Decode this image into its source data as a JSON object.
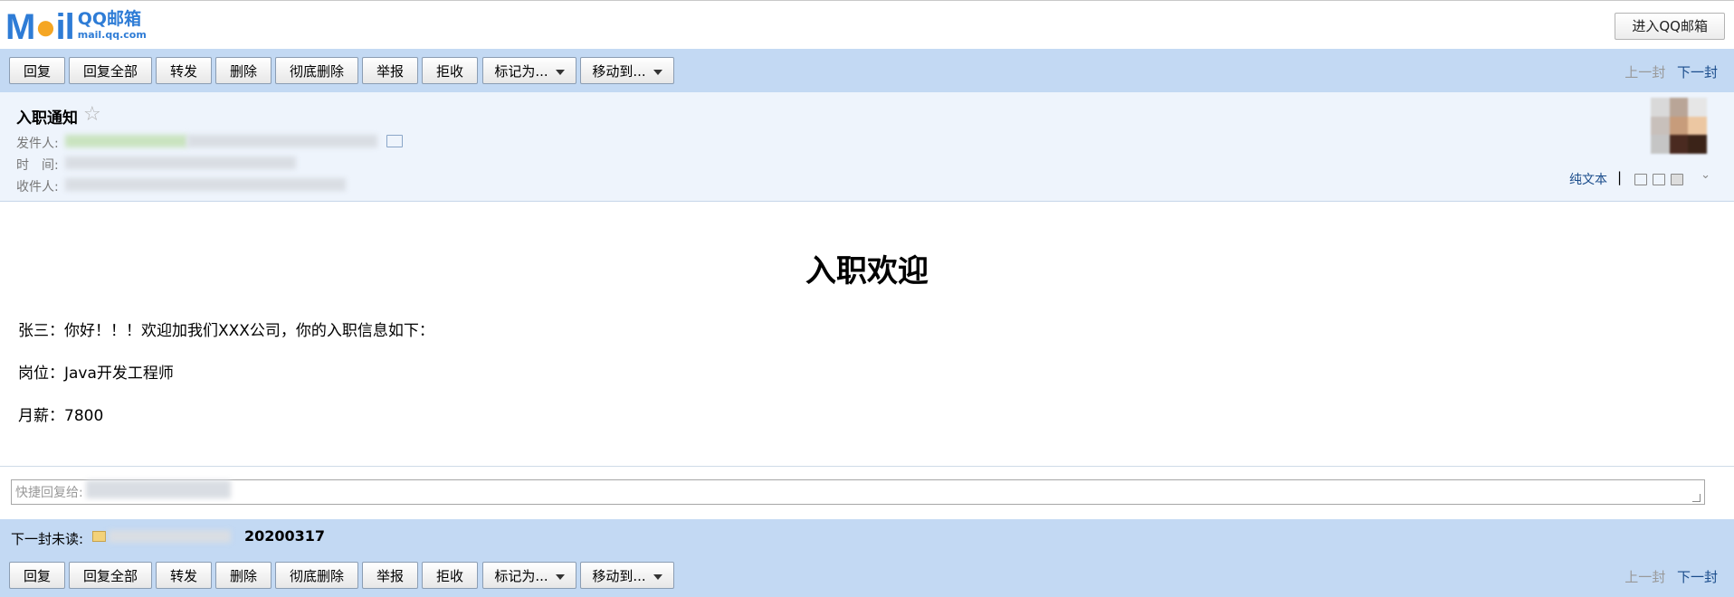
{
  "logo": {
    "mark_m": "M",
    "mark_o": "●",
    "mark_il": "il",
    "brand": "QQ邮箱",
    "domain": "mail.qq.com"
  },
  "enter_button": "进入QQ邮箱",
  "toolbar": {
    "reply": "回复",
    "reply_all": "回复全部",
    "forward": "转发",
    "delete": "删除",
    "delete_permanent": "彻底删除",
    "report": "举报",
    "reject": "拒收",
    "mark_as": "标记为...",
    "move_to": "移动到...",
    "prev": "上一封",
    "next": "下一封"
  },
  "email": {
    "subject": "入职通知",
    "star": "☆",
    "from_label": "发件人:",
    "time_label": "时　间:",
    "to_label": "收件人:",
    "plain_text": "纯文本",
    "separator": "|",
    "expand": "⌄"
  },
  "body": {
    "heading": "入职欢迎",
    "greeting": "张三：你好！！！欢迎加我们XXX公司，你的入职信息如下：",
    "position": "岗位：Java开发工程师",
    "salary": "月薪：7800"
  },
  "quick_reply": {
    "placeholder": "快捷回复给:"
  },
  "next_unread": {
    "label": "下一封未读:",
    "date": "20200317"
  },
  "colors": {
    "toolbar_bg": "#c3d9f3",
    "header_bg": "#eef4fc",
    "link": "#1a4c8b"
  }
}
